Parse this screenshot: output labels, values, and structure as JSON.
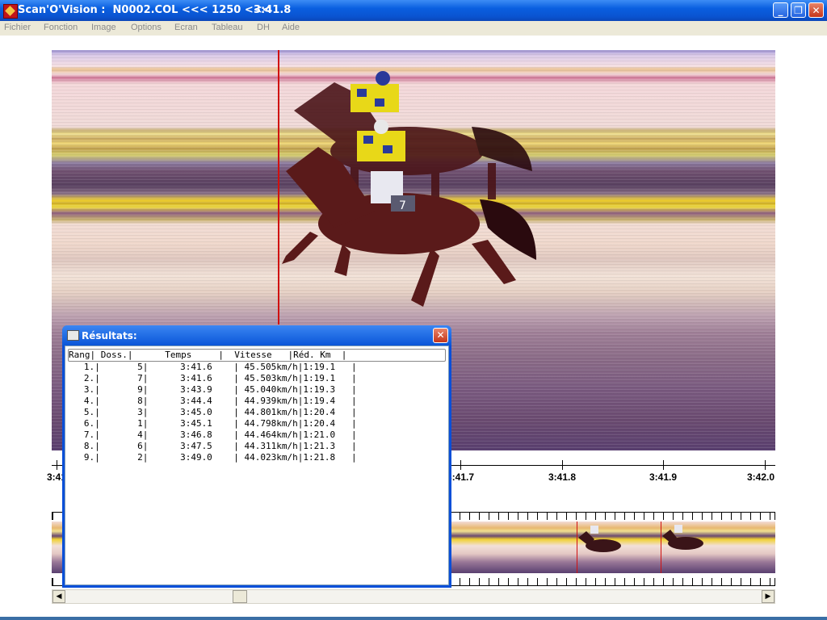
{
  "window": {
    "title": "Scan'O'Vision :  N0002.COL <<< 1250 <<<",
    "time": "3:41.8",
    "minimize_label": "_",
    "maximize_label": "❐",
    "close_label": "✕"
  },
  "menu": [
    "Fichier",
    "Fonction",
    "Image",
    "Options",
    "Ecran",
    "Tableau",
    "DH",
    "Aide"
  ],
  "scale": {
    "labels": [
      "3:41",
      "3:41.7",
      "3:41.8",
      "3:41.9",
      "3:42.0"
    ]
  },
  "dialog": {
    "title": "Résultats:",
    "close_label": "✕",
    "header": "Rang| Doss.|      Temps     |  Vitesse   |Réd. Km  |",
    "rows": [
      "   1.|       5|      3:41.6    | 45.505km/h|1:19.1   |",
      "   2.|       7|      3:41.6    | 45.503km/h|1:19.1   |",
      "   3.|       9|      3:43.9    | 45.040km/h|1:19.3   |",
      "   4.|       8|      3:44.4    | 44.939km/h|1:19.4   |",
      "   5.|       3|      3:45.0    | 44.801km/h|1:20.4   |",
      "   6.|       1|      3:45.1    | 44.798km/h|1:20.4   |",
      "   7.|       4|      3:46.8    | 44.464km/h|1:21.0   |",
      "   8.|       6|      3:47.5    | 44.311km/h|1:21.3   |",
      "   9.|       2|      3:49.0    | 44.023km/h|1:21.8   |"
    ]
  },
  "scrollbar": {
    "left_arrow": "◀",
    "right_arrow": "▶"
  },
  "colors": {
    "titlebar": "#0a55d8",
    "finish_line": "#d01010",
    "menu_bg": "#ece9d8"
  }
}
